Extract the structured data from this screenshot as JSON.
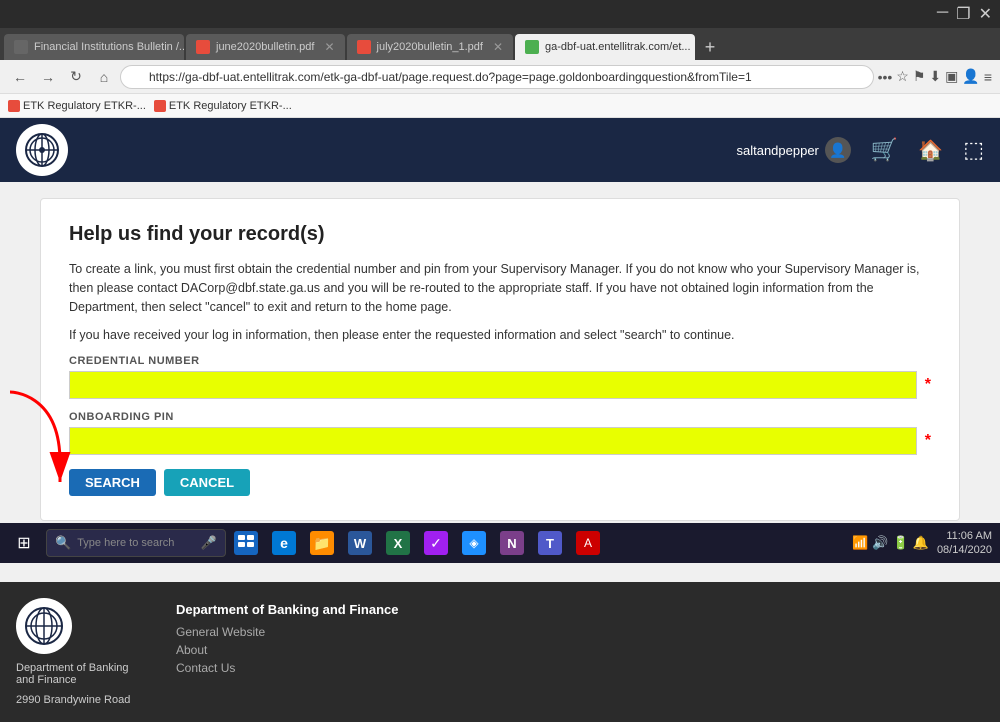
{
  "browser": {
    "tabs": [
      {
        "id": "tab1",
        "label": "Financial Institutions Bulletin /...",
        "active": false,
        "type": "web"
      },
      {
        "id": "tab2",
        "label": "june2020bulletin.pdf",
        "active": false,
        "type": "pdf"
      },
      {
        "id": "tab3",
        "label": "july2020bulletin_1.pdf",
        "active": false,
        "type": "pdf"
      },
      {
        "id": "tab4",
        "label": "ga-dbf-uat.entellitrak.com/et...",
        "active": true,
        "type": "web"
      }
    ],
    "url": "https://ga-dbf-uat.entellitrak.com/etk-ga-dbf-uat/page.request.do?page=page.goldonboardingquestion&fromTile=1",
    "bookmarks": [
      {
        "id": "bm1",
        "label": "ETK Regulatory ETKR-..."
      },
      {
        "id": "bm2",
        "label": "ETK Regulatory ETKR-..."
      }
    ]
  },
  "header": {
    "username": "saltandpepper",
    "cart_icon": "🛒",
    "home_icon": "🏠",
    "logout_icon": "⬚"
  },
  "page": {
    "title": "Help us find your record(s)",
    "description1": "To create a link, you must first obtain the credential number and pin from your Supervisory Manager. If you do not know who your Supervisory Manager is, then please contact DACorp@dbf.state.ga.us and you will be re-routed to the appropriate staff. If you have not obtained login information from the Department, then select \"cancel\" to exit and return to the home page.",
    "description2": "If you have received your log in information, then please enter the requested information and select \"search\" to continue.",
    "credential_label": "CREDENTIAL NUMBER",
    "credential_value": "",
    "pin_label": "ONBOARDING PIN",
    "pin_value": "",
    "search_btn": "SEARCH",
    "cancel_btn": "CANCEL"
  },
  "footer": {
    "org_name": "Department of Banking and Finance",
    "address": "2990 Brandywine Road",
    "links_title": "Department of Banking and Finance",
    "links": [
      {
        "label": "General Website"
      },
      {
        "label": "About"
      },
      {
        "label": "Contact Us"
      }
    ]
  },
  "taskbar": {
    "search_placeholder": "Type here to search",
    "time": "11:06 AM",
    "date": "08/14/2020",
    "apps": [
      {
        "id": "ta1",
        "color": "#0078d4",
        "icon": "⊞",
        "label": "windows"
      },
      {
        "id": "ta2",
        "color": "#1e90ff",
        "icon": "e",
        "label": "edge"
      },
      {
        "id": "ta3",
        "color": "#ff8c00",
        "icon": "🗂",
        "label": "explorer"
      },
      {
        "id": "ta4",
        "color": "#2b579a",
        "icon": "W",
        "label": "word"
      },
      {
        "id": "ta5",
        "color": "#217346",
        "icon": "X",
        "label": "excel"
      },
      {
        "id": "ta6",
        "color": "#a020f0",
        "icon": "✓",
        "label": "check"
      },
      {
        "id": "ta7",
        "color": "#1e90ff",
        "icon": "❖",
        "label": "service"
      },
      {
        "id": "ta8",
        "color": "#7b68ee",
        "icon": "N",
        "label": "onenote"
      },
      {
        "id": "ta9",
        "color": "#0078d4",
        "icon": "◈",
        "label": "teams"
      },
      {
        "id": "ta10",
        "color": "#cc0000",
        "icon": "⬡",
        "label": "acrobat"
      }
    ]
  }
}
